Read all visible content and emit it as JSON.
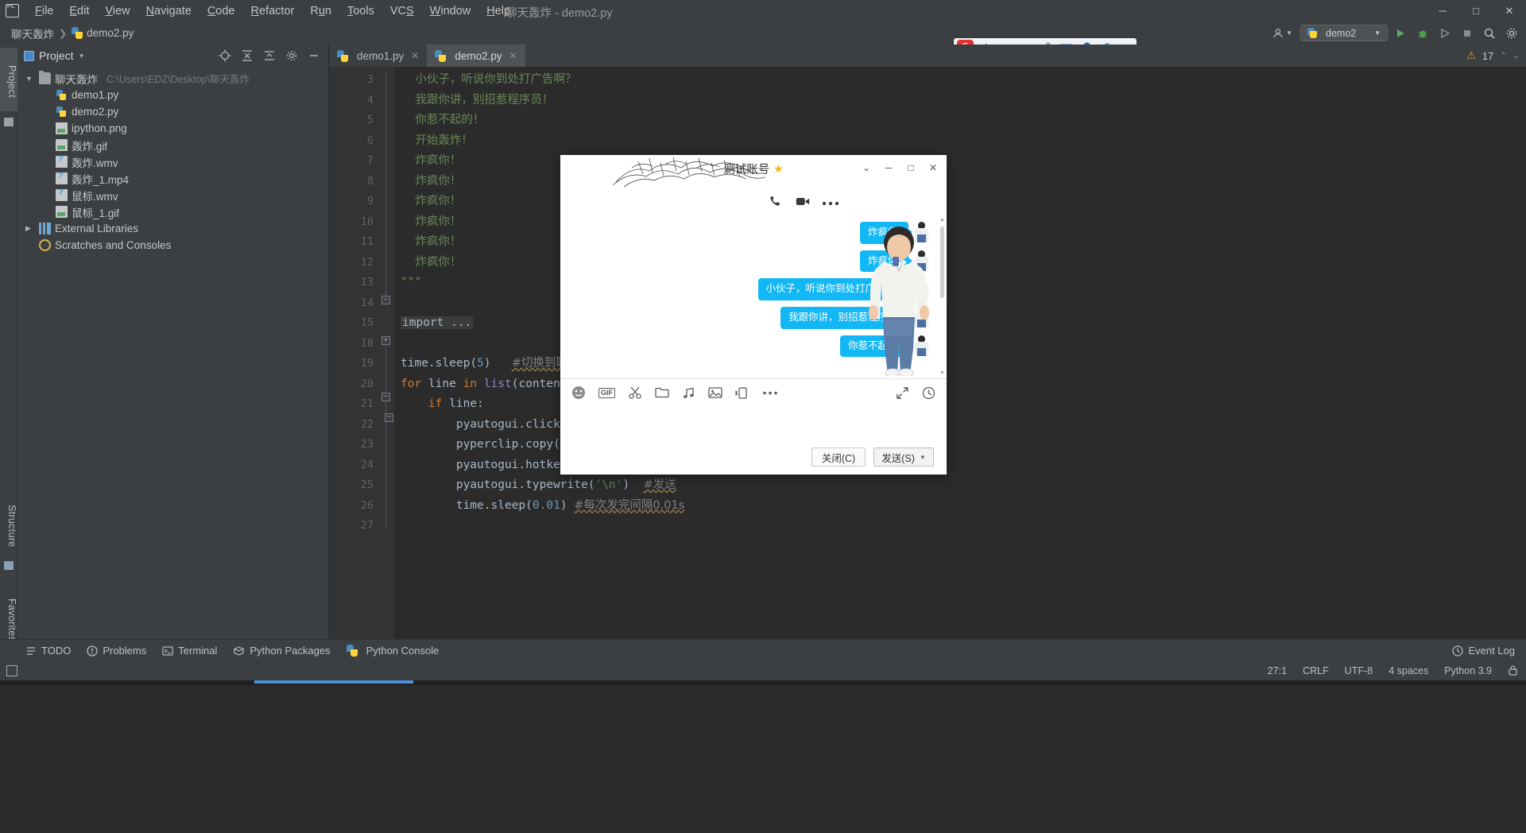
{
  "app": {
    "window_title": "聊天轰炸 - demo2.py",
    "menu": [
      {
        "label": "File"
      },
      {
        "label": "Edit"
      },
      {
        "label": "View"
      },
      {
        "label": "Navigate"
      },
      {
        "label": "Code"
      },
      {
        "label": "Refactor"
      },
      {
        "label": "Run"
      },
      {
        "label": "Tools"
      },
      {
        "label": "VCS"
      },
      {
        "label": "Window"
      },
      {
        "label": "Help"
      }
    ],
    "window_controls": {
      "minimize": "─",
      "maximize": "□",
      "close": "✕"
    }
  },
  "navbar": {
    "breadcrumb": [
      {
        "label": "聊天轰炸",
        "icon": "folder-icon"
      },
      {
        "label": "demo2.py",
        "icon": "python-file-icon"
      }
    ],
    "run_config": "demo2",
    "toolbar_icons": [
      "run-icon",
      "debug-icon",
      "coverage-icon",
      "stop-icon",
      "search-icon",
      "settings-icon"
    ]
  },
  "sidebar_strips": {
    "project": "Project",
    "structure": "Structure",
    "favorites": "Favorites"
  },
  "project_panel": {
    "title": "Project",
    "header_icons": [
      "locate-icon",
      "expand-all-icon",
      "collapse-all-icon",
      "settings-icon",
      "hide-icon"
    ],
    "tree": [
      {
        "label": "聊天轰炸",
        "path": "C:\\Users\\EDZ\\Desktop\\聊天轰炸",
        "icon": "folder-icon",
        "arrow": "v",
        "depth": 0
      },
      {
        "label": "demo1.py",
        "path": "",
        "icon": "python-file-icon",
        "arrow": "",
        "depth": 1
      },
      {
        "label": "demo2.py",
        "path": "",
        "icon": "python-file-icon",
        "arrow": "",
        "depth": 1
      },
      {
        "label": "ipython.png",
        "path": "",
        "icon": "image-file-icon",
        "arrow": "",
        "depth": 1
      },
      {
        "label": "轰炸.gif",
        "path": "",
        "icon": "image-file-icon",
        "arrow": "",
        "depth": 1
      },
      {
        "label": "轰炸.wmv",
        "path": "",
        "icon": "unknown-file-icon",
        "arrow": "",
        "depth": 1
      },
      {
        "label": "轰炸_1.mp4",
        "path": "",
        "icon": "unknown-file-icon",
        "arrow": "",
        "depth": 1
      },
      {
        "label": "鼠标.wmv",
        "path": "",
        "icon": "unknown-file-icon",
        "arrow": "",
        "depth": 1
      },
      {
        "label": "鼠标_1.gif",
        "path": "",
        "icon": "image-file-icon",
        "arrow": "",
        "depth": 1
      },
      {
        "label": "External Libraries",
        "path": "",
        "icon": "library-icon",
        "arrow": ">",
        "depth": 0
      },
      {
        "label": "Scratches and Consoles",
        "path": "",
        "icon": "scratch-icon",
        "arrow": "",
        "depth": 0
      }
    ]
  },
  "editor": {
    "tabs": [
      {
        "label": "demo1.py",
        "active": false
      },
      {
        "label": "demo2.py",
        "active": true
      }
    ],
    "warning_count": "17",
    "lines": [
      {
        "num": "3",
        "text": "小伙子，听说你到处打广告啊？",
        "style": "str",
        "indent": 1
      },
      {
        "num": "4",
        "text": "我跟你讲，别招惹程序员！",
        "style": "str",
        "indent": 1
      },
      {
        "num": "5",
        "text": "你惹不起的！",
        "style": "str",
        "indent": 1
      },
      {
        "num": "6",
        "text": "开始轰炸！",
        "style": "str",
        "indent": 1
      },
      {
        "num": "7",
        "text": "炸疯你！",
        "style": "str",
        "indent": 1
      },
      {
        "num": "8",
        "text": "炸疯你！",
        "style": "str",
        "indent": 1
      },
      {
        "num": "9",
        "text": "炸疯你！",
        "style": "str",
        "indent": 1
      },
      {
        "num": "10",
        "text": "炸疯你！",
        "style": "str",
        "indent": 1
      },
      {
        "num": "11",
        "text": "炸疯你！",
        "style": "str",
        "indent": 1
      },
      {
        "num": "12",
        "text": "炸疯你！",
        "style": "str",
        "indent": 1
      },
      {
        "num": "13",
        "text": "\"\"\"",
        "style": "strm",
        "indent": 0
      },
      {
        "num": "14",
        "text": "",
        "style": "plain",
        "indent": 0
      },
      {
        "num": "15",
        "text": "import ...",
        "style": "fold",
        "indent": 0
      },
      {
        "num": "18",
        "text": "",
        "style": "plain",
        "indent": 0
      },
      {
        "num": "19",
        "text": "time.sleep(5)",
        "style": "code19",
        "indent": 0,
        "comment": "#切换到聊天"
      },
      {
        "num": "20",
        "text": "for line in list(content.",
        "style": "code20",
        "indent": 0
      },
      {
        "num": "21",
        "text": "if line:",
        "style": "code21",
        "indent": 1
      },
      {
        "num": "22",
        "text": "pyautogui.click(",
        "style": "code22",
        "indent": 2
      },
      {
        "num": "23",
        "text": "pyperclip.copy(li",
        "style": "code23",
        "indent": 2
      },
      {
        "num": "24",
        "text": "pyautogui.hotkey(",
        "style": "code24",
        "indent": 2
      },
      {
        "num": "25",
        "text": "pyautogui.typewrite(",
        "style": "code25",
        "indent": 2,
        "comment": "#发送"
      },
      {
        "num": "26",
        "text": "time.sleep(0.01)",
        "style": "code26",
        "indent": 2,
        "comment": "#每次发完间隔0.01s"
      },
      {
        "num": "27",
        "text": "",
        "style": "plain",
        "indent": 0
      }
    ]
  },
  "chat_window": {
    "title": "测试账号",
    "starred": true,
    "header_actions": [
      "phone-call-icon",
      "video-call-icon",
      "more-options-icon"
    ],
    "window_controls": {
      "collapse": "⌄",
      "minimize": "─",
      "maximize": "□",
      "close": "✕"
    },
    "messages": [
      {
        "text": "炸疯你!",
        "side": "right"
      },
      {
        "text": "炸疯你!",
        "side": "right"
      },
      {
        "text": "小伙子，听说你到处打广告啊?",
        "side": "right"
      },
      {
        "text": "我跟你讲，别招惹程序员!",
        "side": "right"
      },
      {
        "text": "你惹不起的!",
        "side": "right"
      }
    ],
    "toolbar_icons": [
      "emoji-icon",
      "gif-icon",
      "screenshot-icon",
      "folder-icon",
      "music-icon",
      "image-icon",
      "shake-window-icon",
      "more-icon"
    ],
    "toolbar_right_icons": [
      "fullscreen-icon",
      "history-icon"
    ],
    "gif_label": "GIF",
    "buttons": {
      "close": "关闭(C)",
      "send": "发送(S)"
    },
    "bubble_color": "#12b7f5"
  },
  "ime": {
    "logo": "S",
    "items": [
      "中",
      "，。",
      "😊",
      "🎤",
      "⌨",
      "👤",
      "👕",
      "▦"
    ]
  },
  "bottom_toolbar": {
    "items": [
      {
        "label": "TODO",
        "icon": "todo-icon"
      },
      {
        "label": "Problems",
        "icon": "problems-icon"
      },
      {
        "label": "Terminal",
        "icon": "terminal-icon"
      },
      {
        "label": "Python Packages",
        "icon": "packages-icon"
      },
      {
        "label": "Python Console",
        "icon": "console-icon"
      }
    ],
    "event_log": "Event Log"
  },
  "statusbar": {
    "caret": "27:1",
    "line_sep": "CRLF",
    "encoding": "UTF-8",
    "indent": "4 spaces",
    "interpreter": "Python 3.9"
  }
}
